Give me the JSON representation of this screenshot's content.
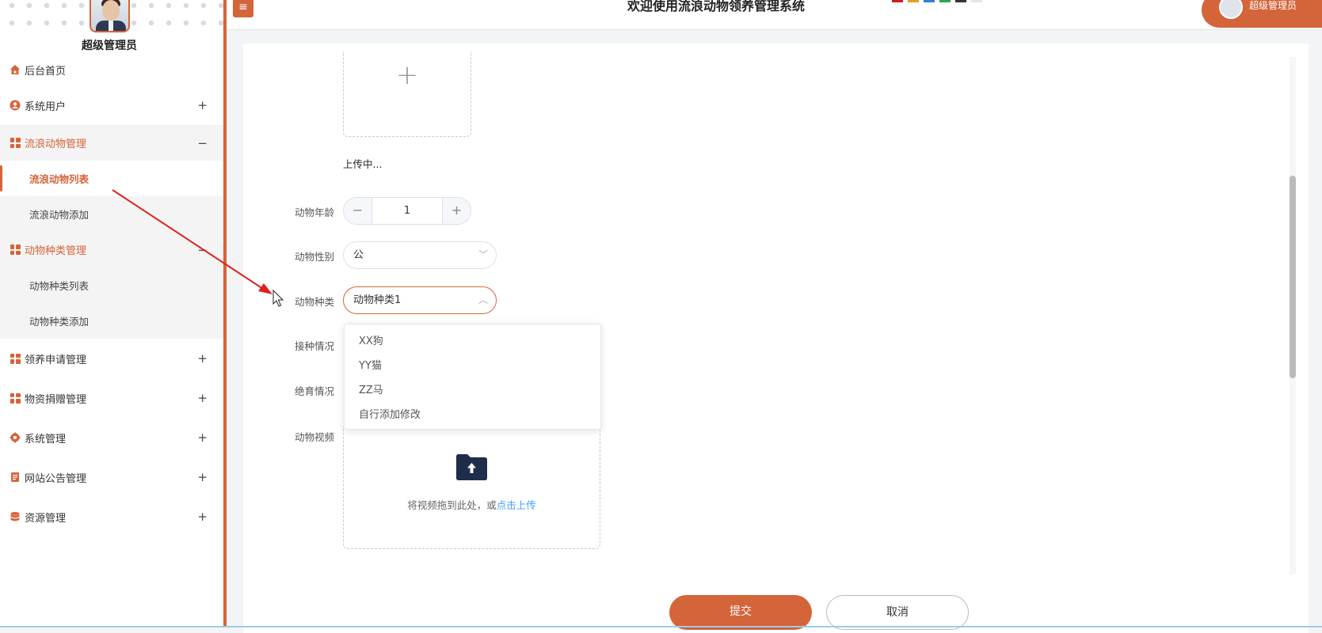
{
  "sidebar": {
    "admin_name": "超级管理员",
    "items": [
      {
        "label": "后台首页",
        "icon": "home-icon",
        "toggle": ""
      },
      {
        "label": "系统用户",
        "icon": "user-icon",
        "toggle": "+"
      },
      {
        "label": "流浪动物管理",
        "icon": "grid-icon",
        "toggle": "−"
      },
      {
        "label": "动物种类管理",
        "icon": "grid-icon",
        "toggle": "−"
      },
      {
        "label": "领养申请管理",
        "icon": "grid-icon",
        "toggle": "+"
      },
      {
        "label": "物资捐赠管理",
        "icon": "grid-icon",
        "toggle": "+"
      },
      {
        "label": "系统管理",
        "icon": "gear-icon",
        "toggle": "+"
      },
      {
        "label": "网站公告管理",
        "icon": "document-icon",
        "toggle": "+"
      },
      {
        "label": "资源管理",
        "icon": "database-icon",
        "toggle": "+"
      }
    ],
    "sub_animals": [
      "流浪动物列表",
      "流浪动物添加"
    ],
    "sub_species": [
      "动物种类列表",
      "动物种类添加"
    ]
  },
  "header": {
    "menu_icon": "≡",
    "title": "欢迎使用流浪动物领养管理系统",
    "user_label": "超级管理员",
    "theme_colors": [
      "#c81e1e",
      "#e0a020",
      "#2a7fd6",
      "#2ea44f",
      "#333333",
      "#e6e6e6"
    ]
  },
  "form": {
    "image_upload_plus": "+",
    "uploading_text": "上传中...",
    "age_label": "动物年龄",
    "age_value": "1",
    "age_minus": "−",
    "age_plus": "+",
    "gender_label": "动物性别",
    "gender_value": "公",
    "species_label": "动物种类",
    "species_value": "动物种类1",
    "vaccine_label": "接种情况",
    "sterilize_label": "绝育情况",
    "video_label": "动物视频",
    "video_hint": "将视频拖到此处，或",
    "video_link": "点击上传",
    "submit": "提交",
    "cancel": "取消"
  },
  "dropdown": {
    "options": [
      "XX狗",
      "YY猫",
      "ZZ马",
      "自行添加修改"
    ]
  },
  "colors": {
    "accent": "#d4643a",
    "link": "#409eff"
  }
}
